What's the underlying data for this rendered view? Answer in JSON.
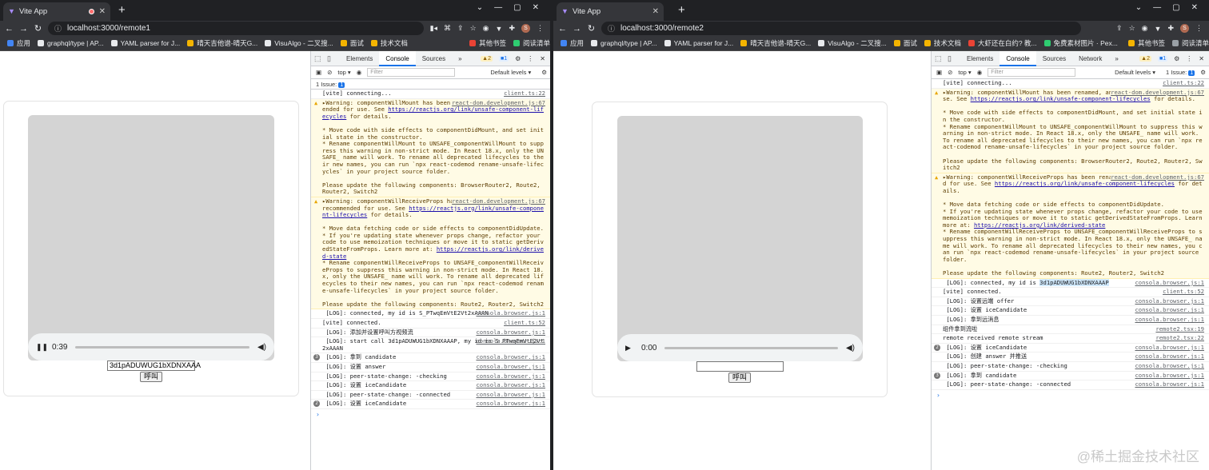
{
  "left": {
    "tab_title": "Vite App",
    "url": "localhost:3000/remote1",
    "bookmarks": [
      "应用",
      "graphql/type | AP...",
      "YAML parser for J...",
      "晴天吉他谱-晴天G...",
      "VisuAlgo - 二叉搜...",
      "面试",
      "技术文档",
      "其他书签",
      "阅读清单"
    ],
    "video_time": "0:39",
    "id_value": "3d1pADUWUG1bXDNXAAA",
    "call_label": "呼叫",
    "devtools": {
      "tabs": [
        "Elements",
        "Console",
        "Sources"
      ],
      "warn_count": "2",
      "info_count": "1",
      "context": "top",
      "filter_placeholder": "Filter",
      "levels": "Default levels",
      "issues": "1 Issue:",
      "issues_count": "1",
      "messages": [
        {
          "kind": "log",
          "text": "[vite] connecting...",
          "src": "client.ts:22"
        },
        {
          "kind": "warn",
          "text": "▸Warning: componentWillMount has been renamed, and is not recommended for use. See https://reactjs.org/link/unsafe-component-lifecycles for details.\n\n* Move code with side effects to componentDidMount, and set initial state in the constructor.\n* Rename componentWillMount to UNSAFE_componentWillMount to suppress this warning in non-strict mode. In React 18.x, only the UNSAFE_ name will work. To rename all deprecated lifecycles to their new names, you can run `npx react-codemod rename-unsafe-lifecycles` in your project source folder.\n\nPlease update the following components: BrowserRouter2, Route2, Router2, Switch2",
          "src": "react-dom.development.js:67"
        },
        {
          "kind": "warn",
          "text": "▸Warning: componentWillReceiveProps has been renamed, and is not recommended for use. See https://reactjs.org/link/unsafe-component-lifecycles for details.\n\n* Move data fetching code or side effects to componentDidUpdate.\n* If you're updating state whenever props change, refactor your code to use memoization techniques or move it to static getDerivedStateFromProps. Learn more at: https://reactjs.org/link/derived-state\n* Rename componentWillReceiveProps to UNSAFE_componentWillReceiveProps to suppress this warning in non-strict mode. In React 18.x, only the UNSAFE_ name will work. To rename all deprecated lifecycles to their new names, you can run `npx react-codemod rename-unsafe-lifecycles` in your project source folder.\n\nPlease update the following components: Route2, Router2, Switch2",
          "src": "react-dom.development.js:67"
        },
        {
          "kind": "log",
          "text": " [LOG]: connected, my id is S_PTwqEmVtE2Vt2xAAAN",
          "src": "consola.browser.js:1"
        },
        {
          "kind": "log",
          "text": "[vite] connected.",
          "src": "client.ts:52"
        },
        {
          "kind": "log",
          "text": " [LOG]: 添加并设置呼叫方视频流",
          "src": "consola.browser.js:1"
        },
        {
          "kind": "log",
          "text": " [LOG]: start call 3d1pADUWUG1bXDNXAAAP, my id is S_PTwqEmVtE2Vt2xAAAN",
          "src": "consola.browser.js:1"
        },
        {
          "kind": "log",
          "count": "3",
          "text": " [LOG]: 拿到 candidate",
          "src": "consola.browser.js:1"
        },
        {
          "kind": "log",
          "text": " [LOG]: 设置 answer",
          "src": "consola.browser.js:1"
        },
        {
          "kind": "log",
          "text": " [LOG]: peer-state-change: -checking",
          "src": "consola.browser.js:1"
        },
        {
          "kind": "log",
          "text": " [LOG]: 设置 iceCandidate",
          "src": "consola.browser.js:1"
        },
        {
          "kind": "log",
          "text": " [LOG]: peer-state-change: -connected",
          "src": "consola.browser.js:1"
        },
        {
          "kind": "log",
          "count": "2",
          "text": " [LOG]: 设置 iceCandidate",
          "src": "consola.browser.js:1"
        }
      ]
    }
  },
  "right": {
    "tab_title": "Vite App",
    "url": "localhost:3000/remote2",
    "bookmarks": [
      "应用",
      "graphql/type | AP...",
      "YAML parser for J...",
      "晴天吉他谱-晴天G...",
      "VisuAlgo - 二叉搜...",
      "面试",
      "技术文档",
      "大虾还在白约? 教...",
      "免费素材图片 · Pex...",
      "其他书签",
      "阅读清单"
    ],
    "video_time": "0:00",
    "id_value": "",
    "call_label": "呼叫",
    "devtools": {
      "tabs": [
        "Elements",
        "Console",
        "Sources",
        "Network"
      ],
      "warn_count": "2",
      "info_count": "1",
      "context": "top",
      "filter_placeholder": "Filter",
      "levels": "Default levels",
      "issues": "1 Issue:",
      "issues_count": "1",
      "messages": [
        {
          "kind": "log",
          "text": "[vite] connecting...",
          "src": "client.ts:22"
        },
        {
          "kind": "warn",
          "text": "▸Warning: componentWillMount has been renamed, and is not recommended for use. See https://reactjs.org/link/unsafe-component-lifecycles for details.\n\n* Move code with side effects to componentDidMount, and set initial state in the constructor.\n* Rename componentWillMount to UNSAFE_componentWillMount to suppress this warning in non-strict mode. In React 18.x, only the UNSAFE_ name will work. To rename all deprecated lifecycles to their new names, you can run `npx react-codemod rename-unsafe-lifecycles` in your project source folder.\n\nPlease update the following components: BrowserRouter2, Route2, Router2, Switch2",
          "src": "react-dom.development.js:67"
        },
        {
          "kind": "warn",
          "text": "▸Warning: componentWillReceiveProps has been renamed, and is not recommended for use. See https://reactjs.org/link/unsafe-component-lifecycles for details.\n\n* Move data fetching code or side effects to componentDidUpdate.\n* If you're updating state whenever props change, refactor your code to use memoization techniques or move it to static getDerivedStateFromProps. Learn more at: https://reactjs.org/link/derived-state\n* Rename componentWillReceiveProps to UNSAFE_componentWillReceiveProps to suppress this warning in non-strict mode. In React 18.x, only the UNSAFE_ name will work. To rename all deprecated lifecycles to their new names, you can run `npx react-codemod rename-unsafe-lifecycles` in your project source folder.\n\nPlease update the following components: Route2, Router2, Switch2",
          "src": "react-dom.development.js:67"
        },
        {
          "kind": "log",
          "text": " [LOG]: connected, my id is 3d1pADUWUG1bXDNXAAAP",
          "src": "consola.browser.js:1",
          "hl": "3d1pADUWUG1bXDNXAAAP"
        },
        {
          "kind": "log",
          "text": "[vite] connected.",
          "src": "client.ts:52"
        },
        {
          "kind": "log",
          "text": " [LOG]: 设置远端 offer",
          "src": "consola.browser.js:1"
        },
        {
          "kind": "log",
          "text": " [LOG]: 设置 iceCandidate",
          "src": "consola.browser.js:1"
        },
        {
          "kind": "log",
          "text": " [LOG]: 拿到远消息",
          "src": "consola.browser.js:1"
        },
        {
          "kind": "log",
          "text": "组件拿到流啦",
          "src": "remote2.tsx:19"
        },
        {
          "kind": "log",
          "text": "remote received remote stream",
          "src": "remote2.tsx:22"
        },
        {
          "kind": "log",
          "count": "2",
          "text": " [LOG]: 设置 iceCandidate",
          "src": "consola.browser.js:1"
        },
        {
          "kind": "log",
          "text": " [LOG]: 创建 answer 并推送",
          "src": "consola.browser.js:1"
        },
        {
          "kind": "log",
          "text": " [LOG]: peer-state-change: -checking",
          "src": "consola.browser.js:1"
        },
        {
          "kind": "log",
          "count": "3",
          "text": " [LOG]: 拿到 candidate",
          "src": "consola.browser.js:1"
        },
        {
          "kind": "log",
          "text": " [LOG]: peer-state-change: -connected",
          "src": "consola.browser.js:1"
        }
      ]
    }
  },
  "watermark": "@稀土掘金技术社区",
  "colors": {
    "chrome_dark": "#202124",
    "chrome_bar": "#35363a",
    "warn_bg": "#fffbe5",
    "accent": "#1a73e8"
  }
}
